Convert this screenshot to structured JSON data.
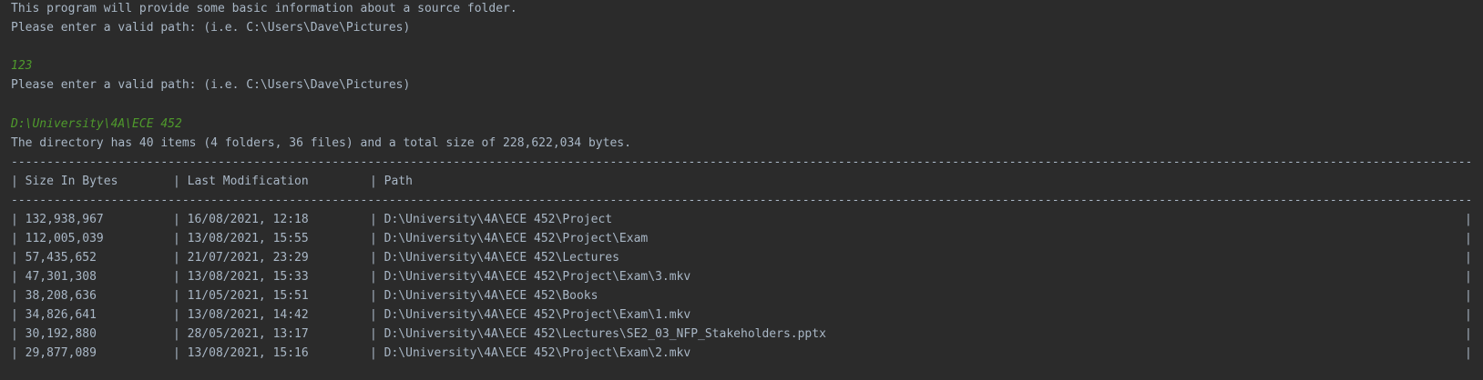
{
  "console": {
    "intro": "This program will provide some basic information about a source folder.",
    "prompt1": "Please enter a valid path: (i.e. C:\\Users\\Dave\\Pictures)",
    "input1": "123",
    "prompt2": "Please enter a valid path: (i.e. C:\\Users\\Dave\\Pictures)",
    "input2": "D:\\University\\4A\\ECE 452",
    "summary": "The directory has 40 items (4 folders, 36 files) and a total size of 228,622,034 bytes.",
    "rule": "------------------------------------------------------------------------------------------------------------------------------------------------------------------------------------------------------------------------------------------------------------------------------",
    "pipe": "|",
    "headers": {
      "size": "| Size In Bytes",
      "date": "| Last Modification",
      "path": "| Path"
    },
    "rows": [
      {
        "size": "| 132,938,967",
        "date": "| 16/08/2021, 12:18",
        "path": "| D:\\University\\4A\\ECE 452\\Project"
      },
      {
        "size": "| 112,005,039",
        "date": "| 13/08/2021, 15:55",
        "path": "| D:\\University\\4A\\ECE 452\\Project\\Exam"
      },
      {
        "size": "| 57,435,652",
        "date": "| 21/07/2021, 23:29",
        "path": "| D:\\University\\4A\\ECE 452\\Lectures"
      },
      {
        "size": "| 47,301,308",
        "date": "| 13/08/2021, 15:33",
        "path": "| D:\\University\\4A\\ECE 452\\Project\\Exam\\3.mkv"
      },
      {
        "size": "| 38,208,636",
        "date": "| 11/05/2021, 15:51",
        "path": "| D:\\University\\4A\\ECE 452\\Books"
      },
      {
        "size": "| 34,826,641",
        "date": "| 13/08/2021, 14:42",
        "path": "| D:\\University\\4A\\ECE 452\\Project\\Exam\\1.mkv"
      },
      {
        "size": "| 30,192,880",
        "date": "| 28/05/2021, 13:17",
        "path": "| D:\\University\\4A\\ECE 452\\Lectures\\SE2_03_NFP_Stakeholders.pptx"
      },
      {
        "size": "| 29,877,089",
        "date": "| 13/08/2021, 15:16",
        "path": "| D:\\University\\4A\\ECE 452\\Project\\Exam\\2.mkv"
      }
    ],
    "colors": {
      "background": "#2b2b2b",
      "text": "#a9b7c6",
      "user_input": "#4f9a2c"
    }
  }
}
